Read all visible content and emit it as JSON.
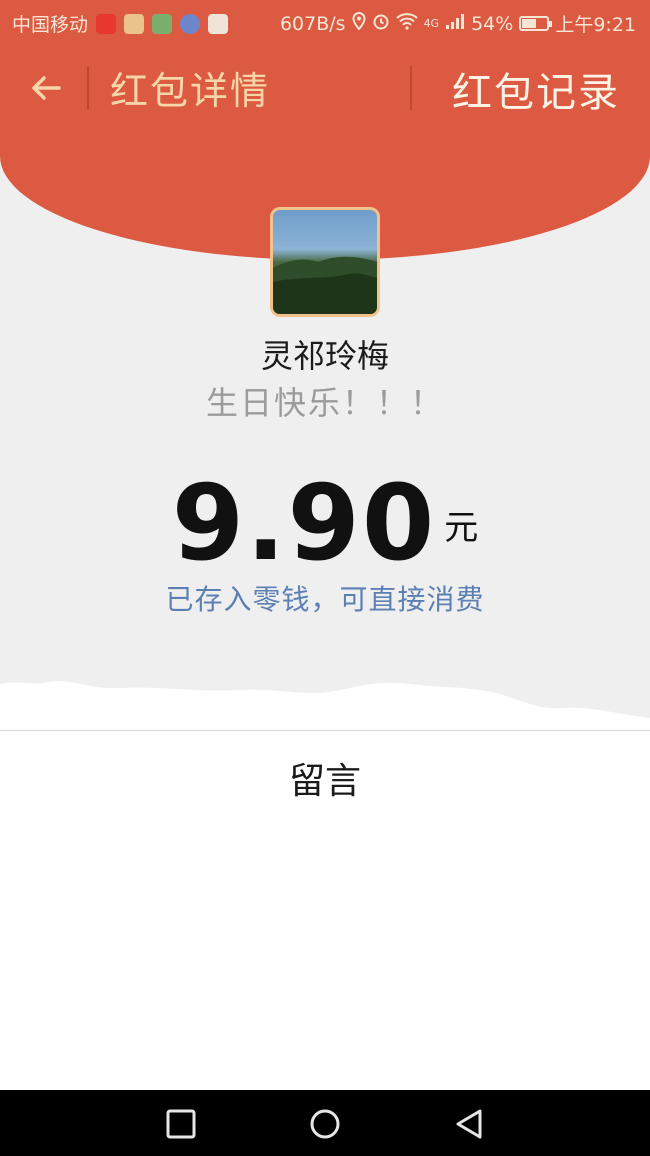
{
  "status_bar": {
    "carrier": "中国移动",
    "net_speed": "607B/s",
    "network_type": "4G",
    "battery_percent": "54%",
    "time": "上午9:21",
    "icons": [
      "weibo-icon",
      "paper-plane-app-icon",
      "news-app-icon",
      "browser-app-icon",
      "map-pin-app-icon",
      "location-icon",
      "alarm-icon",
      "wifi-icon",
      "signal-icon",
      "battery-icon"
    ]
  },
  "nav": {
    "back_icon": "arrow-left-icon",
    "title": "红包详情",
    "action_label": "红包记录"
  },
  "red_packet": {
    "sender_name": "灵祁玲梅",
    "greeting": "生日快乐！！！",
    "amount": "9.90",
    "currency_unit": "元",
    "stored_note": "已存入零钱，可直接消费"
  },
  "message_section": {
    "label": "留言"
  },
  "colors": {
    "header_red": "#dc5a41",
    "header_text_gold": "#f6d6a8",
    "note_blue": "#5c7fb4",
    "avatar_border": "#f3c28a"
  },
  "system_nav": {
    "icons": [
      "recent-apps-square-icon",
      "home-circle-icon",
      "back-triangle-icon"
    ]
  }
}
